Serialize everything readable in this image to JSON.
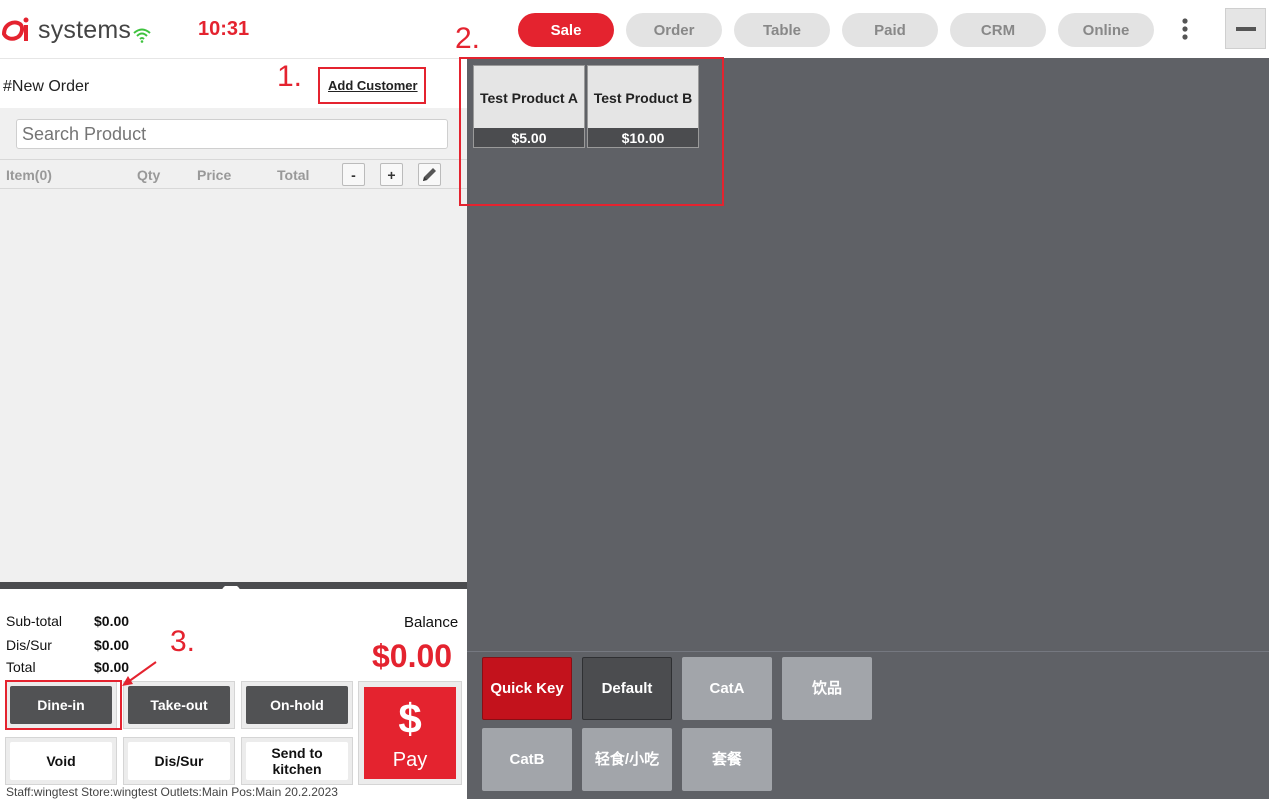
{
  "logo": {
    "text": "systems"
  },
  "clock": "10:31",
  "nav": [
    {
      "label": "Sale",
      "active": true
    },
    {
      "label": "Order",
      "active": false
    },
    {
      "label": "Table",
      "active": false
    },
    {
      "label": "Paid",
      "active": false
    },
    {
      "label": "CRM",
      "active": false
    },
    {
      "label": "Online",
      "active": false
    }
  ],
  "order": {
    "title": "#New Order",
    "add_customer": "Add Customer",
    "search_placeholder": "Search Product"
  },
  "items_table": {
    "headers": {
      "item": "Item(0)",
      "qty": "Qty",
      "price": "Price",
      "total": "Total"
    },
    "minus": "-",
    "plus": "+"
  },
  "totals": {
    "subtotal_label": "Sub-total",
    "subtotal_value": "$0.00",
    "dissur_label": "Dis/Sur",
    "dissur_value": "$0.00",
    "total_label": "Total",
    "total_value": "$0.00",
    "balance_label": "Balance",
    "balance_value": "$0.00"
  },
  "actions": {
    "dine_in": "Dine-in",
    "take_out": "Take-out",
    "on_hold": "On-hold",
    "void": "Void",
    "dis_sur": "Dis/Sur",
    "send_to_kitchen": "Send to kitchen",
    "pay_symbol": "$",
    "pay": "Pay"
  },
  "status_line": "Staff:wingtest Store:wingtest  Outlets:Main  Pos:Main 20.2.2023",
  "products": [
    {
      "name": "Test Product A",
      "price": "$5.00"
    },
    {
      "name": "Test Product B",
      "price": "$10.00"
    }
  ],
  "categories": [
    {
      "label": "Quick Key",
      "state": "active"
    },
    {
      "label": "Default",
      "state": "dark"
    },
    {
      "label": "CatA",
      "state": "normal"
    },
    {
      "label": "饮品",
      "state": "normal"
    },
    {
      "label": "CatB",
      "state": "normal"
    },
    {
      "label": "轻食/小吃",
      "state": "normal"
    },
    {
      "label": "套餐",
      "state": "normal"
    }
  ],
  "annotations": {
    "one": "1.",
    "two": "2.",
    "three": "3."
  },
  "colors": {
    "accent": "#e4232f",
    "panel": "#5f6166",
    "dark_button": "#515254"
  },
  "icons": [
    "logo-mark-icon",
    "wifi-icon",
    "more-vertical-icon",
    "minimize-icon",
    "pencil-icon",
    "chevron-down-icon",
    "dollar-icon",
    "arrow-icon"
  ]
}
